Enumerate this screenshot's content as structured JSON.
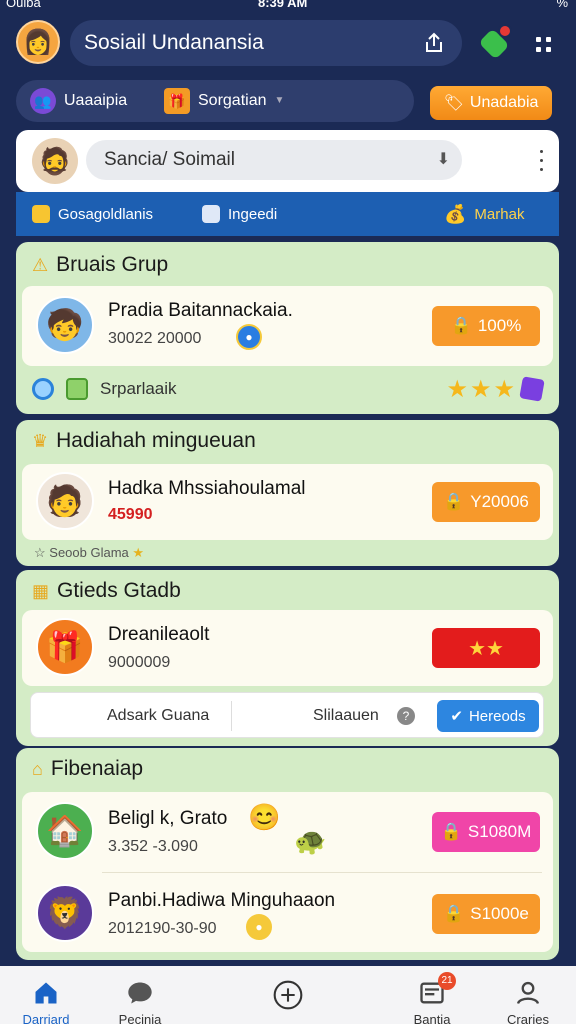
{
  "status_bar": {
    "carrier": "Oulba",
    "time": "8:39 AM",
    "battery": "%"
  },
  "header": {
    "title": "Sosiail Undanansia"
  },
  "filters": {
    "item1": "Uaaaipia",
    "item2": "Sorgatian",
    "unread_label": "Unadabia"
  },
  "search": {
    "value": "Sancia/ Soimail"
  },
  "categories": {
    "item1": "Gosagoldlanis",
    "item2": "Ingeedi",
    "item3": "Marhak"
  },
  "section1": {
    "title": "Bruais Grup",
    "item": {
      "name": "Pradia Baitannackaia.",
      "sub": "30022 20000",
      "button": "100%"
    },
    "footer_label": "Srparlaaik"
  },
  "section2": {
    "title": "Hadiahah mingueuan",
    "item": {
      "name": "Hadka Mhssiahoulamal",
      "sub": "45990",
      "button": "Y20006"
    },
    "caption": "Seoob Glama"
  },
  "section3": {
    "title": "Gtieds  Gtadb",
    "item": {
      "name": "Dreanileaolt",
      "sub": "9000009",
      "button": "★★"
    },
    "bar": {
      "left": "Adsark Guana",
      "right": "Slilaauen",
      "button": "Hereods"
    }
  },
  "section4": {
    "title": "Fibenaiap",
    "item1": {
      "name": "Beligl k, Grato",
      "sub": "3.352 -3.090",
      "button": "S1080M"
    },
    "item2": {
      "name": "Panbi.Hadiwa Minguhaaon",
      "sub": "2012190-30-90",
      "button": "S1000e"
    }
  },
  "nav": {
    "home": "Darriard",
    "chat": "Pecinia",
    "inbox": "Bantia",
    "profile": "Craries",
    "inbox_badge": "21"
  },
  "colors": {
    "background": "#1b2a55",
    "section_green": "#d4ecc6",
    "accent_orange": "#f7992b",
    "accent_blue": "#1d5fb2"
  },
  "icons": [
    "avatar",
    "share-icon",
    "gift-icon",
    "more-icon",
    "search-caret-icon",
    "kebab-icon",
    "star-icon",
    "home-icon",
    "chat-icon",
    "add-icon",
    "inbox-icon",
    "profile-icon"
  ]
}
